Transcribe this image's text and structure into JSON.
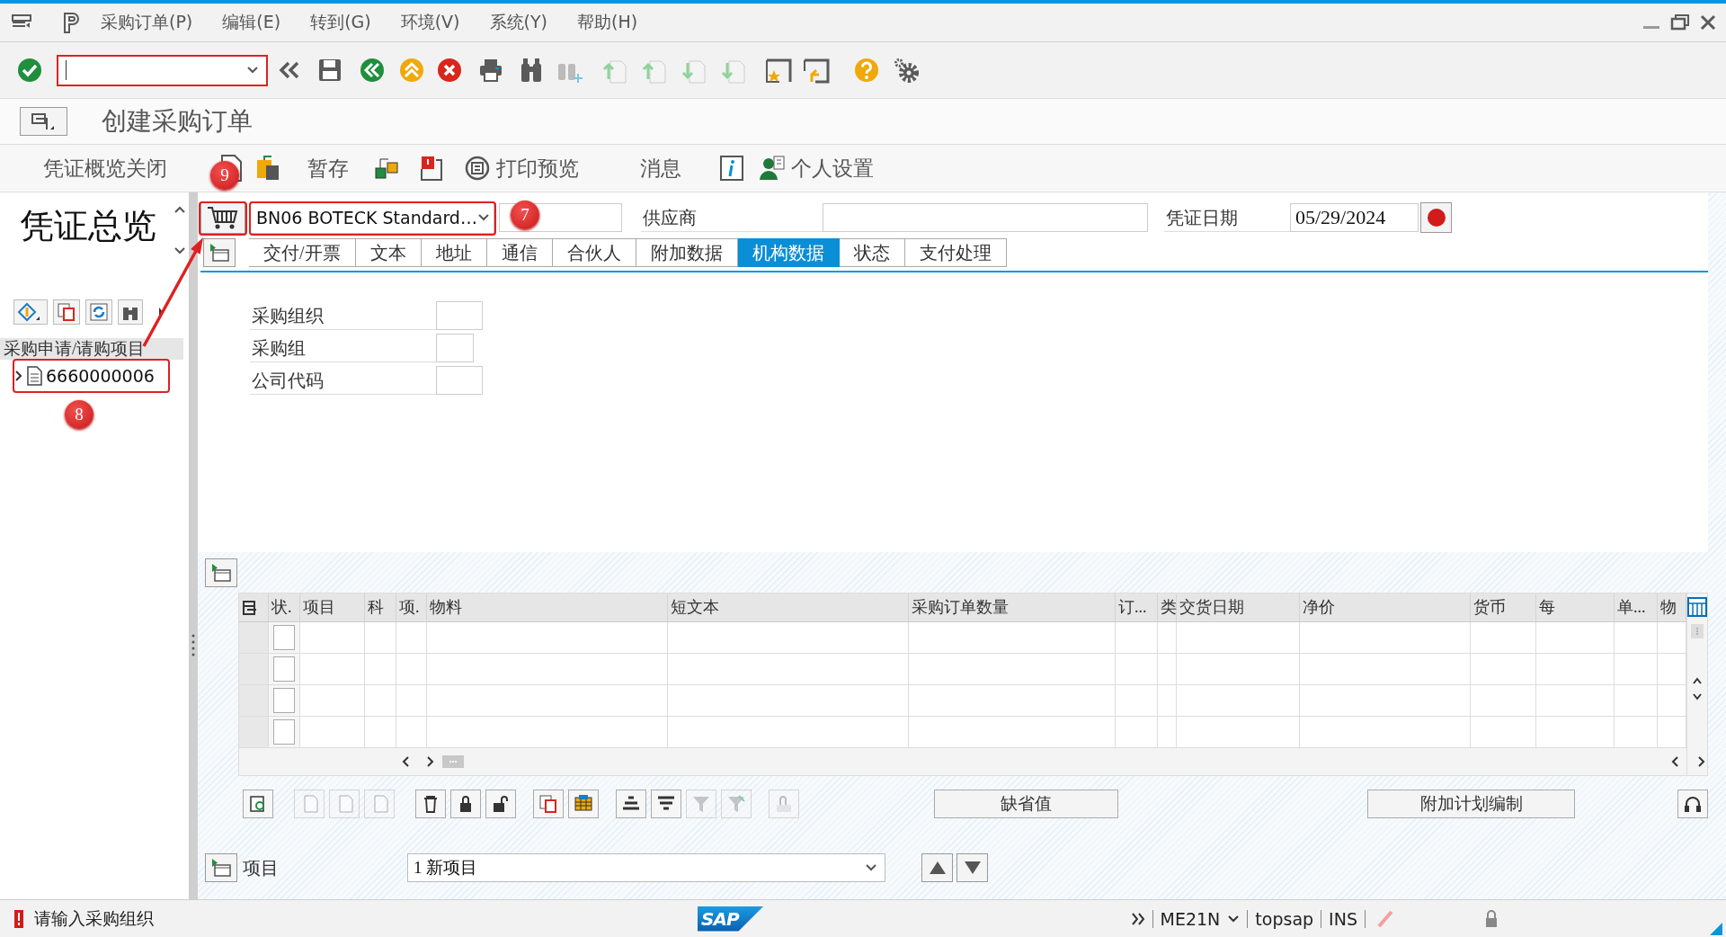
{
  "menu_bar": {
    "items": [
      "采购订单(P)",
      "编辑(E)",
      "转到(G)",
      "环境(V)",
      "系统(Y)",
      "帮助(H)"
    ]
  },
  "title": "创建采购订单",
  "app_toolbar": {
    "items": [
      "凭证概览关闭",
      "暂存",
      "打印预览",
      "消息",
      "个人设置"
    ]
  },
  "left_panel": {
    "title": "凭证总览",
    "list_header": "采购申请/请购项目",
    "tree": [
      {
        "label": "6660000006",
        "expanded": false
      }
    ]
  },
  "header": {
    "document_type": "BN06 BOTECK Standard…",
    "supplier_label": "供应商",
    "date_label": "凭证日期",
    "date_value": "05/29/2024"
  },
  "tabs": [
    {
      "label": "交付/开票",
      "selected": false
    },
    {
      "label": "文本",
      "selected": false
    },
    {
      "label": "地址",
      "selected": false
    },
    {
      "label": "通信",
      "selected": false
    },
    {
      "label": "合伙人",
      "selected": false
    },
    {
      "label": "附加数据",
      "selected": false
    },
    {
      "label": "机构数据",
      "selected": true
    },
    {
      "label": "状态",
      "selected": false
    },
    {
      "label": "支付处理",
      "selected": false
    }
  ],
  "org_fields": [
    {
      "label": "采购组织"
    },
    {
      "label": "采购组"
    },
    {
      "label": "公司代码"
    }
  ],
  "items_table": {
    "columns": [
      "状.",
      "项目",
      "科",
      "项.",
      "物料",
      "短文本",
      "采购订单数量",
      "订...",
      "类",
      "交货日期",
      "净价",
      "货币",
      "每",
      "单...",
      "物"
    ],
    "rows": [
      {
        "selected": false
      },
      {
        "selected": false
      },
      {
        "selected": false
      },
      {
        "selected": false
      }
    ]
  },
  "item_buttons": [
    "缺省值",
    "附加计划编制"
  ],
  "item_nav": {
    "label": "项目",
    "selection": "1 新项目"
  },
  "status_bar": {
    "kind": "error",
    "message": "请输入采购组织",
    "logo": "SAP",
    "transaction": "ME21N",
    "user": "topsap",
    "mode": "INS"
  },
  "annotations": [
    {
      "number": "9"
    },
    {
      "number": "7"
    },
    {
      "number": "8"
    }
  ]
}
